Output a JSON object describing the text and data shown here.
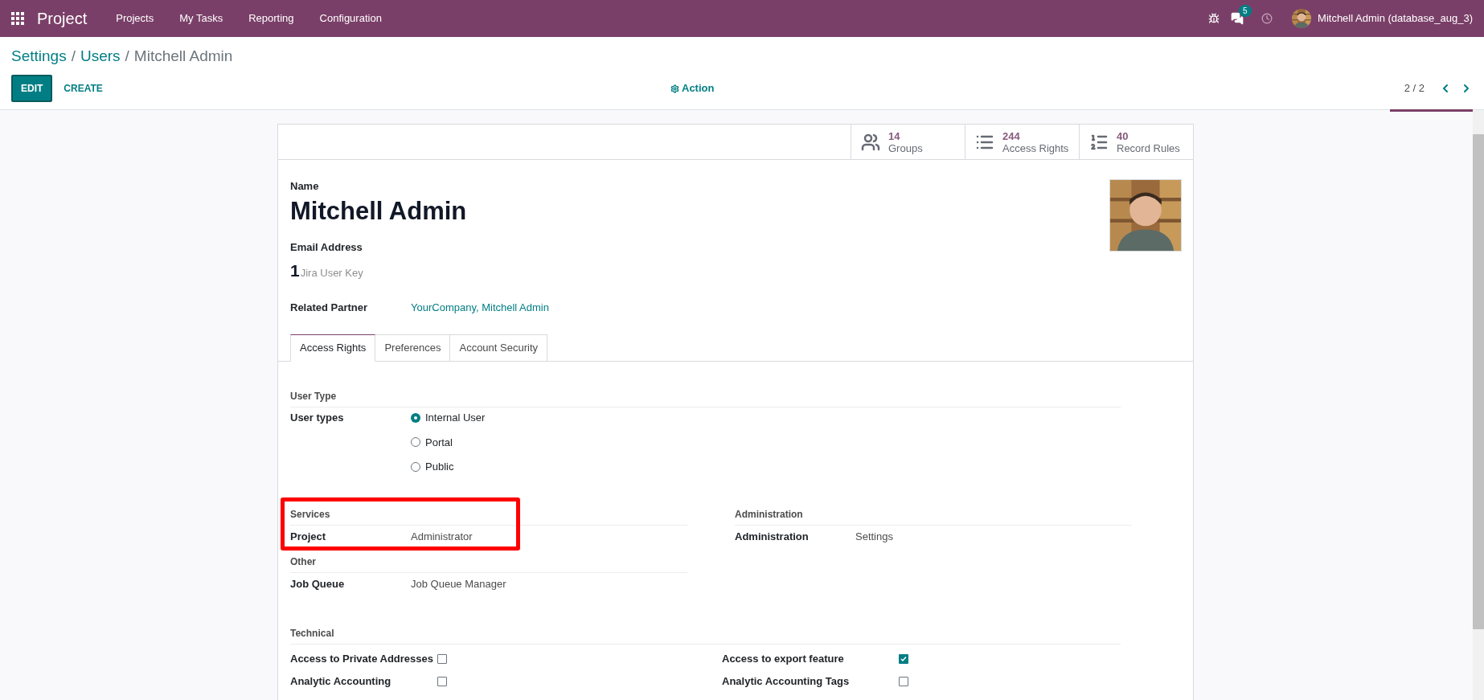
{
  "navbar": {
    "app_title": "Project",
    "menu": [
      "Projects",
      "My Tasks",
      "Reporting",
      "Configuration"
    ],
    "chat_badge": "5",
    "user": "Mitchell Admin (database_aug_3)"
  },
  "breadcrumbs": {
    "separator": "/",
    "items": [
      {
        "label": "Settings",
        "kind": "link"
      },
      {
        "label": "Users",
        "kind": "link"
      },
      {
        "label": "Mitchell Admin",
        "kind": "current"
      }
    ]
  },
  "control_panel": {
    "buttons": [
      {
        "label": "EDIT",
        "kind": "primary"
      },
      {
        "label": "CREATE",
        "kind": "secondary"
      }
    ],
    "action": "Action",
    "pager": "2 / 2"
  },
  "stat_buttons": [
    {
      "value": "14",
      "label": "Groups",
      "kind": "users"
    },
    {
      "value": "244",
      "label": "Access Rights",
      "kind": "list"
    },
    {
      "value": "40",
      "label": "Record Rules",
      "kind": "bullets"
    }
  ],
  "form": {
    "name_label": "Name",
    "name": "Mitchell Admin",
    "email_label": "Email Address",
    "email_value": "1",
    "jira_key_placeholder": "Jira User Key",
    "partner_label": "Related Partner",
    "partner_value": "YourCompany, Mitchell Admin"
  },
  "tabs": [
    {
      "label": "Access Rights",
      "selected": true
    },
    {
      "label": "Preferences",
      "selected": false
    },
    {
      "label": "Account Security",
      "selected": false
    }
  ],
  "user_type": {
    "title": "User Type",
    "label": "User types",
    "options": [
      {
        "label": "Internal User",
        "selected": true
      },
      {
        "label": "Portal",
        "selected": false
      },
      {
        "label": "Public",
        "selected": false
      }
    ]
  },
  "groups_left": [
    {
      "title": "Services",
      "highlighted": true,
      "rows": [
        {
          "label": "Project",
          "value": "Administrator"
        }
      ]
    },
    {
      "title": "Other",
      "highlighted": false,
      "rows": [
        {
          "label": "Job Queue",
          "value": "Job Queue Manager"
        }
      ]
    }
  ],
  "groups_right": [
    {
      "title": "Administration",
      "highlighted": false,
      "rows": [
        {
          "label": "Administration",
          "value": "Settings"
        }
      ]
    }
  ],
  "technical": {
    "title": "Technical",
    "items": [
      {
        "label": "Access to Private Addresses",
        "checked": false
      },
      {
        "label": "Access to export feature",
        "checked": true
      },
      {
        "label": "Analytic Accounting",
        "checked": false
      },
      {
        "label": "Analytic Accounting Tags",
        "checked": false
      }
    ]
  }
}
